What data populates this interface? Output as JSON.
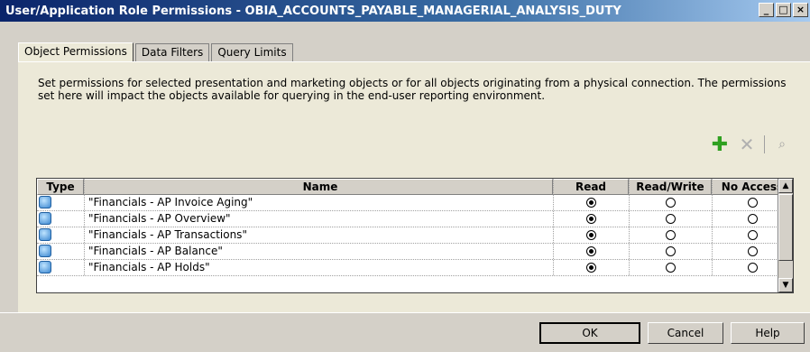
{
  "window": {
    "title": "User/Application Role Permissions - OBIA_ACCOUNTS_PAYABLE_MANAGERIAL_ANALYSIS_DUTY",
    "controls": {
      "minimize": "_",
      "maximize": "□",
      "close": "×"
    }
  },
  "tabs": [
    {
      "label": "Object Permissions",
      "active": true
    },
    {
      "label": "Data Filters",
      "active": false
    },
    {
      "label": "Query Limits",
      "active": false
    }
  ],
  "description": "Set permissions for selected presentation and marketing objects or for all objects originating from a physical connection. The permissions set here will impact the objects available for querying in the end-user reporting environment.",
  "toolbar": {
    "add_icon": "plus-icon",
    "delete_icon": "x-icon",
    "find_icon": "binoculars-icon"
  },
  "table": {
    "columns": [
      "Type",
      "Name",
      "Read",
      "Read/Write",
      "No Access"
    ],
    "rows": [
      {
        "type_icon": "subject-area-icon",
        "name": "\"Financials - AP Invoice Aging\"",
        "permission": "Read"
      },
      {
        "type_icon": "subject-area-icon",
        "name": "\"Financials - AP Overview\"",
        "permission": "Read"
      },
      {
        "type_icon": "subject-area-icon",
        "name": "\"Financials - AP Transactions\"",
        "permission": "Read"
      },
      {
        "type_icon": "subject-area-icon",
        "name": "\"Financials - AP Balance\"",
        "permission": "Read"
      },
      {
        "type_icon": "subject-area-icon",
        "name": "\"Financials - AP Holds\"",
        "permission": "Read"
      }
    ]
  },
  "buttons": {
    "ok": "OK",
    "cancel": "Cancel",
    "help": "Help"
  }
}
